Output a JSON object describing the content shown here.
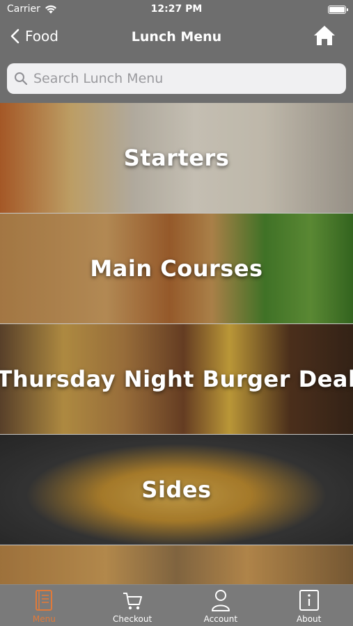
{
  "status_bar": {
    "carrier": "Carrier",
    "time": "12:27 PM"
  },
  "nav": {
    "back_label": "Food",
    "title": "Lunch Menu"
  },
  "search": {
    "placeholder": "Search Lunch Menu",
    "value": ""
  },
  "menu_items": [
    {
      "label": "Starters",
      "image": "starters-photo"
    },
    {
      "label": "Main Courses",
      "image": "main-courses-photo"
    },
    {
      "label": "Thursday Night Burger Deal",
      "image": "burger-photo"
    },
    {
      "label": "Sides",
      "image": "fries-photo"
    },
    {
      "label": "",
      "image": "burgers-photo"
    }
  ],
  "tab_bar": {
    "tabs": [
      {
        "label": "Menu",
        "icon": "menu-book-icon",
        "active": true
      },
      {
        "label": "Checkout",
        "icon": "cart-icon",
        "active": false
      },
      {
        "label": "Account",
        "icon": "person-icon",
        "active": false
      },
      {
        "label": "About",
        "icon": "info-icon",
        "active": false
      }
    ]
  },
  "colors": {
    "accent": "#e07a3a",
    "header_bg": "#6e6e6e",
    "tab_bg": "#7a7a7a"
  }
}
